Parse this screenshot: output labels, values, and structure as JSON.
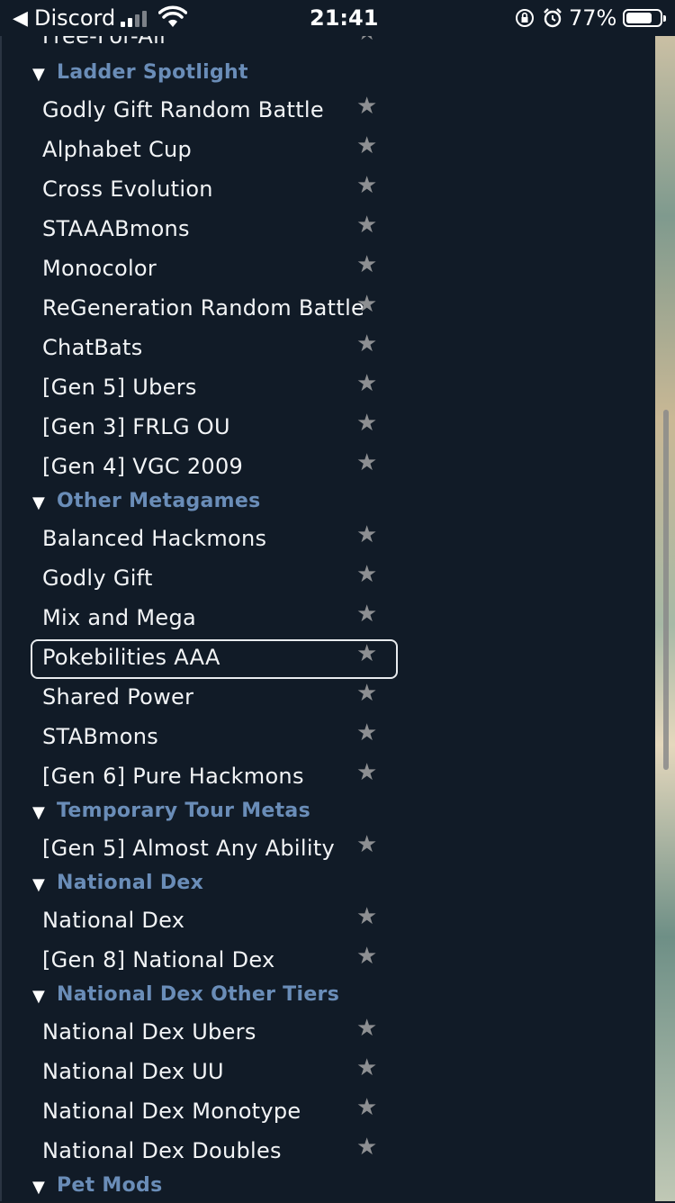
{
  "status_bar": {
    "app_name": "Discord",
    "time": "21:41",
    "battery_percent": "77%",
    "battery_level": 0.77
  },
  "list": {
    "partial_top_item": "Free-For-All",
    "sections": [
      {
        "title": "Ladder Spotlight",
        "items": [
          "Godly Gift Random Battle",
          "Alphabet Cup",
          "Cross Evolution",
          "STAAABmons",
          "Monocolor",
          "ReGeneration Random Battle",
          "ChatBats",
          "[Gen 5] Ubers",
          "[Gen 3] FRLG OU",
          "[Gen 4] VGC 2009"
        ]
      },
      {
        "title": "Other Metagames",
        "items": [
          "Balanced Hackmons",
          "Godly Gift",
          "Mix and Mega",
          "Pokebilities AAA",
          "Shared Power",
          "STABmons",
          "[Gen 6] Pure Hackmons"
        ]
      },
      {
        "title": "Temporary Tour Metas",
        "items": [
          "[Gen 5] Almost Any Ability"
        ]
      },
      {
        "title": "National Dex",
        "items": [
          "National Dex",
          "[Gen 8] National Dex"
        ]
      },
      {
        "title": "National Dex Other Tiers",
        "items": [
          "National Dex Ubers",
          "National Dex UU",
          "National Dex Monotype",
          "National Dex Doubles"
        ]
      },
      {
        "title": "Pet Mods",
        "items": []
      }
    ],
    "selected_item": "Pokebilities AAA"
  },
  "icons": {
    "collapse": "triangle-down-icon",
    "favorite": "star-icon"
  },
  "colors": {
    "background": "#111b27",
    "section_title": "#6a8db8",
    "item_text": "#f2f4f6",
    "star": "#8d8f92"
  }
}
